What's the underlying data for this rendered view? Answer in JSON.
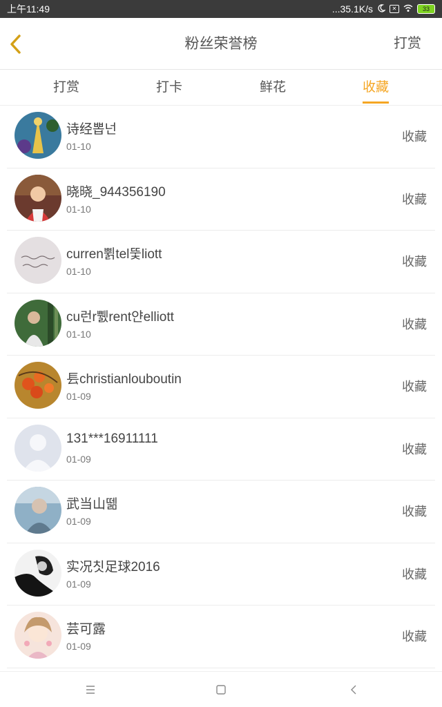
{
  "status_bar": {
    "time": "上午11:49",
    "network_speed": "...35.1K/s",
    "battery": "33",
    "icons": [
      "moon-icon",
      "sim-x-icon",
      "wifi-icon",
      "battery-icon"
    ]
  },
  "header": {
    "title": "粉丝荣誉榜",
    "action": "打赏",
    "back_icon": "chevron-left-icon"
  },
  "tabs": [
    {
      "label": "打赏",
      "active": false
    },
    {
      "label": "打卡",
      "active": false
    },
    {
      "label": "鲜花",
      "active": false
    },
    {
      "label": "收藏",
      "active": true
    }
  ],
  "list": [
    {
      "name": "诗经뽑넌",
      "date": "01-10",
      "action": "收藏"
    },
    {
      "name": "晓晓_944356190",
      "date": "01-10",
      "action": "收藏"
    },
    {
      "name": "curren쀩tel뚳liott",
      "date": "01-10",
      "action": "收藏"
    },
    {
      "name": "cu런r쀐rent얀elliott",
      "date": "01-10",
      "action": "收藏"
    },
    {
      "name": "镸christianlouboutin",
      "date": "01-09",
      "action": "收藏"
    },
    {
      "name": "131***16911111",
      "date": "01-09",
      "action": "收藏"
    },
    {
      "name": "武当山뗆",
      "date": "01-09",
      "action": "收藏"
    },
    {
      "name": "实况칫足球2016",
      "date": "01-09",
      "action": "收藏"
    },
    {
      "name": "芸可露",
      "date": "01-09",
      "action": "收藏"
    }
  ],
  "colors": {
    "accent": "#f5a623",
    "status_bar_bg": "#3b3b3b",
    "text": "#444444"
  },
  "nav": {
    "icons": [
      "menu-icon",
      "home-square-icon",
      "back-triangle-icon"
    ]
  }
}
